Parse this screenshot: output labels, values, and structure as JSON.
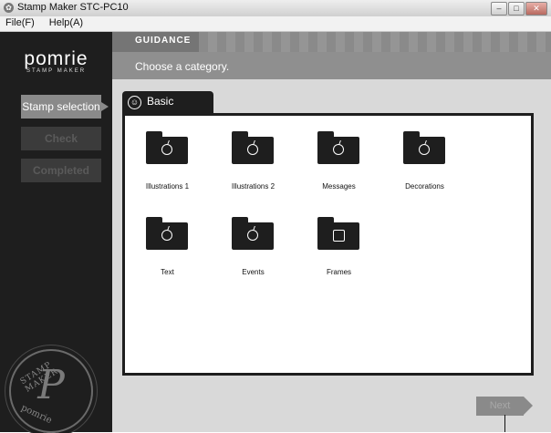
{
  "window": {
    "title": "Stamp Maker STC-PC10",
    "icon": "app-icon",
    "controls": [
      "minimize",
      "maximize",
      "close"
    ]
  },
  "menu": {
    "items": [
      "File(F)",
      "Help(A)"
    ]
  },
  "sidebar": {
    "logo": "pomrie",
    "logo_sub": "STAMP MAKER",
    "steps": [
      {
        "label": "Stamp selection",
        "state": "active"
      },
      {
        "label": "Check",
        "state": "disabled"
      },
      {
        "label": "Completed",
        "state": "disabled"
      }
    ],
    "seal": {
      "top_text": "STAMP MAKER",
      "letter": "P",
      "bottom_text": "pomrie"
    }
  },
  "guidance": {
    "label": "GUIDANCE",
    "message": "Choose a category."
  },
  "category_tab": {
    "label": "Basic",
    "icon": "smiley-icon"
  },
  "categories": [
    {
      "label": "Illustrations 1",
      "icon": "apple-folder-icon"
    },
    {
      "label": "Illustrations 2",
      "icon": "apple-folder-icon"
    },
    {
      "label": "Messages",
      "icon": "apple-folder-icon"
    },
    {
      "label": "Decorations",
      "icon": "apple-folder-icon"
    },
    {
      "label": "Text",
      "icon": "apple-folder-icon"
    },
    {
      "label": "Events",
      "icon": "apple-folder-icon"
    },
    {
      "label": "Frames",
      "icon": "frame-folder-icon"
    }
  ],
  "next_button": {
    "label": "Next",
    "state": "disabled"
  },
  "colors": {
    "sidebar_bg": "#1e1e1e",
    "guidance_bg": "#8f8f8f",
    "main_bg": "#d9d9d9",
    "active_step": "#8a8a8a"
  }
}
